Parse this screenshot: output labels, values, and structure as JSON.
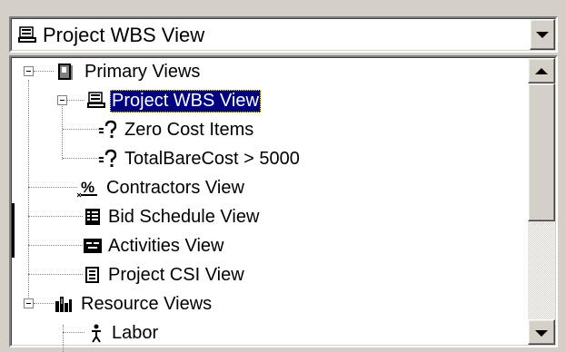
{
  "combo": {
    "value": "Project WBS View",
    "icon": "project-view-icon"
  },
  "tree": {
    "items": [
      {
        "label": "Primary Views",
        "icon": "primary-views-icon",
        "level": 0,
        "expanded": true
      },
      {
        "label": "Project WBS View",
        "icon": "project-view-icon",
        "level": 1,
        "expanded": true,
        "selected": true
      },
      {
        "label": "Zero Cost Items",
        "icon": "filter-query-icon",
        "level": 2
      },
      {
        "label": "TotalBareCost > 5000",
        "icon": "filter-query-icon",
        "level": 2
      },
      {
        "label": "Contractors View",
        "icon": "percent-icon",
        "level": 1
      },
      {
        "label": "Bid Schedule View",
        "icon": "bid-schedule-icon",
        "level": 1
      },
      {
        "label": "Activities View",
        "icon": "activities-icon",
        "level": 1
      },
      {
        "label": "Project CSI View",
        "icon": "csi-icon",
        "level": 1
      },
      {
        "label": "Resource Views",
        "icon": "resource-views-icon",
        "level": 0,
        "expanded": true
      },
      {
        "label": "Labor",
        "icon": "labor-person-icon",
        "level": 1
      }
    ]
  },
  "scrollbar": {
    "position": 0.0
  },
  "colors": {
    "selection": "#000080",
    "face": "#d4d0c8"
  }
}
